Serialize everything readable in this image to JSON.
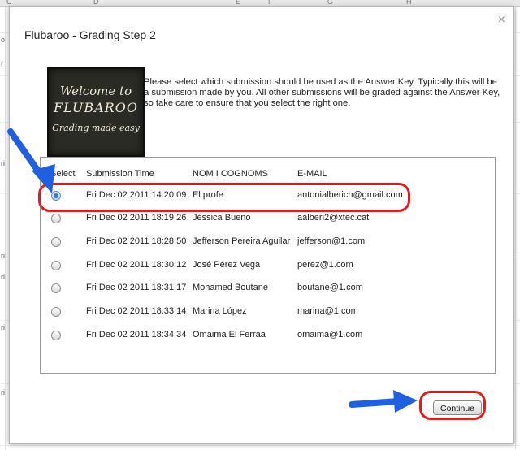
{
  "background": {
    "column_letters": [
      "C",
      "D",
      "E",
      "F",
      "G",
      "H"
    ],
    "edge_fragments": [
      "o",
      "f",
      "ri",
      "ri",
      "ri",
      "ri",
      "ri"
    ]
  },
  "dialog": {
    "title": "Flubaroo - Grading Step 2",
    "close_label": "×",
    "logo": {
      "line1": "Welcome to",
      "line2": "FLUBAROO",
      "line3": "Grading made easy"
    },
    "instructions": "Please select which submission should be used as the Answer Key. Typically this will be a submission made by you. All other submissions will be graded against the Answer Key, so take care to ensure that you select the right one.",
    "table": {
      "headers": [
        "Select",
        "Submission Time",
        "NOM I COGNOMS",
        "E-MAIL"
      ],
      "rows": [
        {
          "time": "Fri Dec 02 2011 14:20:09",
          "name": "El profe",
          "email": "antonialberich@gmail.com",
          "selected": true
        },
        {
          "time": "Fri Dec 02 2011 18:19:26",
          "name": "Jéssica Bueno",
          "email": "aalberi2@xtec.cat",
          "selected": false
        },
        {
          "time": "Fri Dec 02 2011 18:28:50",
          "name": "Jefferson Pereira Aguilar",
          "email": "jefferson@1.com",
          "selected": false
        },
        {
          "time": "Fri Dec 02 2011 18:30:12",
          "name": "José Pérez Vega",
          "email": "perez@1.com",
          "selected": false
        },
        {
          "time": "Fri Dec 02 2011 18:31:17",
          "name": "Mohamed Boutane",
          "email": "boutane@1.com",
          "selected": false
        },
        {
          "time": "Fri Dec 02 2011 18:33:14",
          "name": "Marina López",
          "email": "marina@1.com",
          "selected": false
        },
        {
          "time": "Fri Dec 02 2011 18:34:34",
          "name": "Omaima El Ferraa",
          "email": "omaima@1.com",
          "selected": false
        }
      ]
    },
    "continue_label": "Continue"
  },
  "colors": {
    "annotation_red": "#e31b1b",
    "annotation_blue": "#1f5fe0",
    "radio_selected": "#3a78d8"
  }
}
